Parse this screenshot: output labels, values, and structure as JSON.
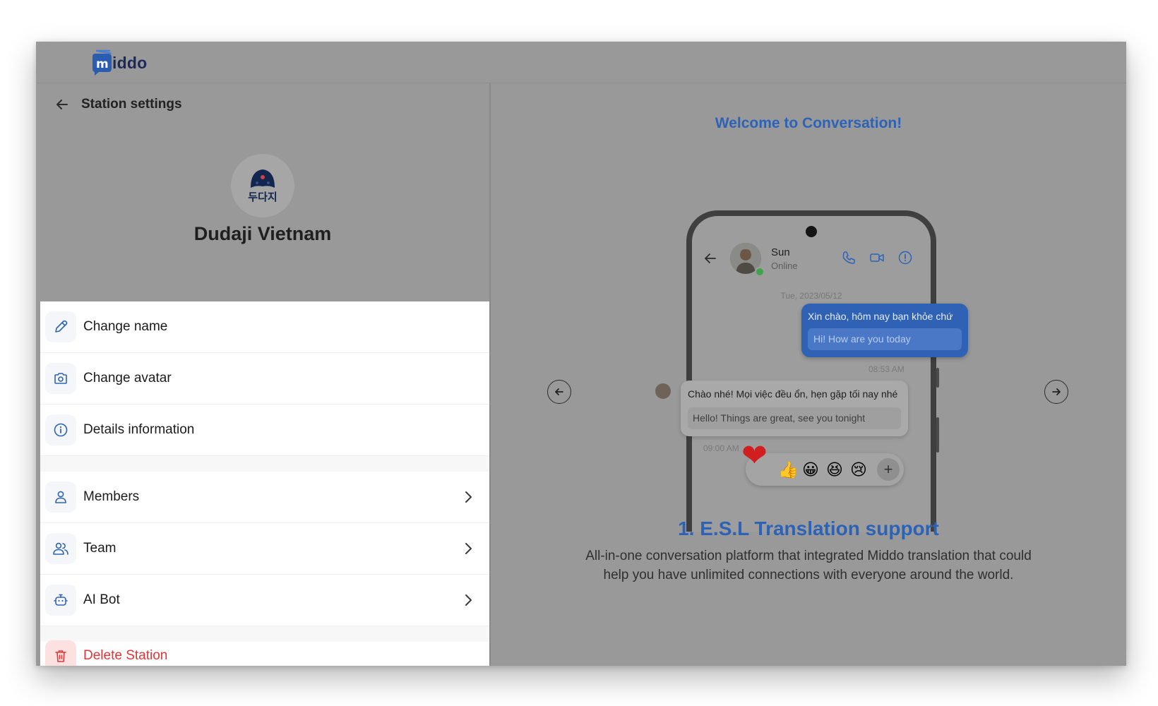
{
  "app": {
    "logo_text": "iddo"
  },
  "left_panel": {
    "header_title": "Station settings",
    "station_name": "Dudaji Vietnam",
    "avatar_text": "두다지",
    "menu": {
      "change_name": "Change name",
      "change_avatar": "Change avatar",
      "details_information": "Details information",
      "members": "Members",
      "team": "Team",
      "ai_bot": "AI Bot",
      "delete_station": "Delete Station"
    }
  },
  "right_panel": {
    "welcome_title": "Welcome to Conversation!",
    "phone": {
      "contact_name": "Sun",
      "contact_status": "Online",
      "date": "Tue, 2023/05/12",
      "outgoing_text": "Xin chào, hôm nay bạn khỏe chứ",
      "outgoing_translation": "Hi! How are you today",
      "outgoing_time": "08:53 AM",
      "incoming_text": "Chào nhé! Mọi việc đều ổn, hẹn gặp tối nay nhé",
      "incoming_translation": "Hello! Things are great, see you tonight",
      "incoming_time": "09:00 AM",
      "reactions": [
        "❤",
        "👍",
        "😀",
        "😆",
        "😢"
      ],
      "add_reaction": "+"
    },
    "feature_title": "1. E.S.L Translation support",
    "feature_description": "All-in-one conversation platform that integrated Middo translation that could help you have unlimited connections with everyone around the world."
  },
  "colors": {
    "accent": "#2d63b7",
    "danger": "#e33535",
    "overlay": "#999999"
  }
}
